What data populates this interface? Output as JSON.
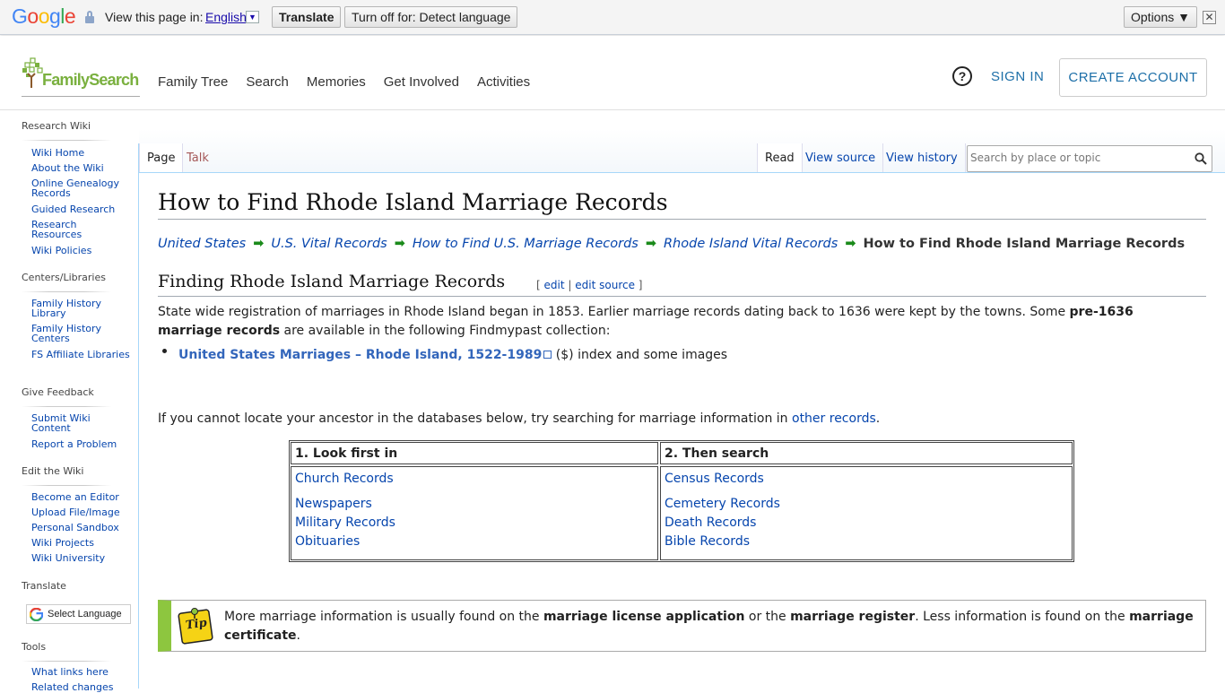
{
  "translate_bar": {
    "logo": "Google",
    "view_page_in": "View this page in:",
    "language": "English",
    "translate_button": "Translate",
    "turn_off_button": "Turn off for: Detect language",
    "options_button": "Options ▼",
    "close": "✕"
  },
  "header": {
    "logo_text": "FamilySearch",
    "nav": [
      "Family Tree",
      "Search",
      "Memories",
      "Get Involved",
      "Activities"
    ],
    "help": "?",
    "sign_in": "SIGN IN",
    "create_account": "CREATE ACCOUNT"
  },
  "sidebar": {
    "sections": [
      {
        "title": "Research Wiki",
        "items": [
          "Wiki Home",
          "About the Wiki",
          "Online Genealogy Records",
          "Guided Research",
          "Research Resources",
          "Wiki Policies"
        ]
      },
      {
        "title": "Centers/Libraries",
        "items": [
          "Family History Library",
          "Family History Centers",
          "FS Affiliate Libraries"
        ]
      },
      {
        "title": "Give Feedback",
        "items": [
          "Submit Wiki Content",
          "Report a Problem"
        ]
      },
      {
        "title": "Edit the Wiki",
        "items": [
          "Become an Editor",
          "Upload File/Image",
          "Personal Sandbox",
          "Wiki Projects",
          "Wiki University"
        ]
      },
      {
        "title": "Translate",
        "items": []
      },
      {
        "title": "Tools",
        "items": [
          "What links here",
          "Related changes"
        ]
      }
    ],
    "select_language": "Select Language"
  },
  "tabs": {
    "page": "Page",
    "talk": "Talk",
    "read": "Read",
    "view_source": "View source",
    "view_history": "View history",
    "search_placeholder": "Search by place or topic"
  },
  "article": {
    "title": "How to Find Rhode Island Marriage Records",
    "breadcrumbs": [
      "United States",
      "U.S. Vital Records",
      "How to Find U.S. Marriage Records",
      "Rhode Island Vital Records"
    ],
    "breadcrumb_current": "How to Find Rhode Island Marriage Records",
    "section_title": "Finding Rhode Island Marriage Records",
    "edit_links": {
      "open": "[",
      "edit": "edit",
      "sep": "|",
      "edit_source": "edit source",
      "close": "]"
    },
    "intro_part1": "State wide registration of marriages in Rhode Island began in 1853. Earlier marriage records dating back to 1636 were kept by the towns. Some ",
    "intro_bold": "pre-1636 marriage records",
    "intro_part2": " are available in the following Findmypast collection:",
    "collection_link": "United States Marriages – Rhode Island, 1522-1989",
    "collection_suffix": " ($) index and some images",
    "cannot_locate": "If you cannot locate your ancestor in the databases below, try searching for marriage information in ",
    "other_records": "other records",
    "period": ".",
    "table": {
      "col1_header": "1. Look first in",
      "col2_header": "2. Then search",
      "col1_links": [
        "Church Records",
        "Newspapers",
        "Military Records",
        "Obituaries"
      ],
      "col2_links": [
        "Census Records",
        "Cemetery Records",
        "Death Records",
        "Bible Records"
      ]
    },
    "tip": {
      "icon_text": "Tip",
      "part1": "More marriage information is usually found on the ",
      "bold1": "marriage license application",
      "part2": " or the ",
      "bold2": "marriage register",
      "part3": ". Less information is found on the ",
      "bold3": "marriage certificate",
      "part4": "."
    }
  }
}
